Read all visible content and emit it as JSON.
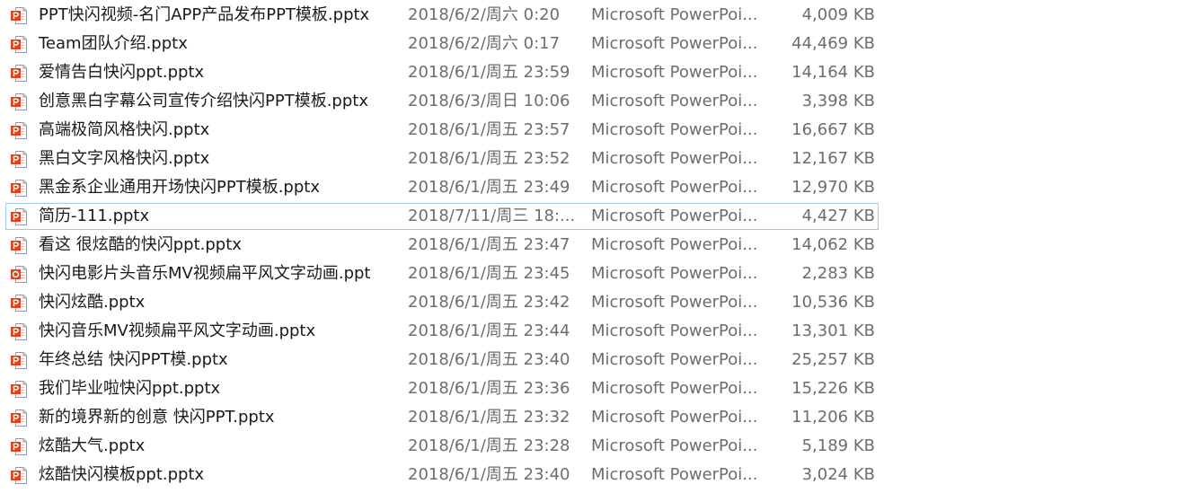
{
  "colors": {
    "accent_focus_border": "#99c9ef",
    "icon_red": "#d24726",
    "text_primary": "#1a1a1a",
    "text_secondary": "#6d6d6d"
  },
  "files": [
    {
      "name": "PPT快闪视频-名门APP产品发布PPT模板.pptx",
      "date": "2018/6/2/周六 0:20",
      "type": "Microsoft PowerPoi...",
      "size": "4,009 KB",
      "icon": "pptx-file-icon"
    },
    {
      "name": "Team团队介绍.pptx",
      "date": "2018/6/2/周六 0:17",
      "type": "Microsoft PowerPoi...",
      "size": "44,469 KB",
      "icon": "pptx-file-icon"
    },
    {
      "name": "爱情告白快闪ppt.pptx",
      "date": "2018/6/1/周五 23:59",
      "type": "Microsoft PowerPoi...",
      "size": "14,164 KB",
      "icon": "pptx-file-icon"
    },
    {
      "name": "创意黑白字幕公司宣传介绍快闪PPT模板.pptx",
      "date": "2018/6/3/周日 10:06",
      "type": "Microsoft PowerPoi...",
      "size": "3,398 KB",
      "icon": "pptx-file-icon"
    },
    {
      "name": "高端极简风格快闪.pptx",
      "date": "2018/6/1/周五 23:57",
      "type": "Microsoft PowerPoi...",
      "size": "16,667 KB",
      "icon": "pptx-file-icon"
    },
    {
      "name": "黑白文字风格快闪.pptx",
      "date": "2018/6/1/周五 23:52",
      "type": "Microsoft PowerPoi...",
      "size": "12,167 KB",
      "icon": "pptx-file-icon"
    },
    {
      "name": "黑金系企业通用开场快闪PPT模板.pptx",
      "date": "2018/6/1/周五 23:49",
      "type": "Microsoft PowerPoi...",
      "size": "12,970 KB",
      "icon": "pptx-file-icon"
    },
    {
      "name": "简历-111.pptx",
      "date": "2018/7/11/周三 18:...",
      "type": "Microsoft PowerPoi...",
      "size": "4,427 KB",
      "icon": "pptx-file-icon",
      "focused": true
    },
    {
      "name": "看这 很炫酷的快闪ppt.pptx",
      "date": "2018/6/1/周五 23:47",
      "type": "Microsoft PowerPoi...",
      "size": "14,062 KB",
      "icon": "pptx-file-icon"
    },
    {
      "name": "快闪电影片头音乐MV视频扁平风文字动画.ppt",
      "date": "2018/6/1/周五 23:45",
      "type": "Microsoft PowerPoi...",
      "size": "2,283 KB",
      "icon": "ppt-file-icon"
    },
    {
      "name": "快闪炫酷.pptx",
      "date": "2018/6/1/周五 23:42",
      "type": "Microsoft PowerPoi...",
      "size": "10,536 KB",
      "icon": "pptx-file-icon"
    },
    {
      "name": "快闪音乐MV视频扁平风文字动画.pptx",
      "date": "2018/6/1/周五 23:44",
      "type": "Microsoft PowerPoi...",
      "size": "13,301 KB",
      "icon": "pptx-file-icon"
    },
    {
      "name": "年终总结 快闪PPT模.pptx",
      "date": "2018/6/1/周五 23:40",
      "type": "Microsoft PowerPoi...",
      "size": "25,257 KB",
      "icon": "pptx-file-icon"
    },
    {
      "name": "我们毕业啦快闪ppt.pptx",
      "date": "2018/6/1/周五 23:36",
      "type": "Microsoft PowerPoi...",
      "size": "15,226 KB",
      "icon": "pptx-file-icon"
    },
    {
      "name": "新的境界新的创意 快闪PPT.pptx",
      "date": "2018/6/1/周五 23:32",
      "type": "Microsoft PowerPoi...",
      "size": "11,206 KB",
      "icon": "pptx-file-icon"
    },
    {
      "name": "炫酷大气.pptx",
      "date": "2018/6/1/周五 23:28",
      "type": "Microsoft PowerPoi...",
      "size": "5,189 KB",
      "icon": "pptx-file-icon"
    },
    {
      "name": "炫酷快闪模板ppt.pptx",
      "date": "2018/6/1/周五 23:40",
      "type": "Microsoft PowerPoi...",
      "size": "3,024 KB",
      "icon": "pptx-file-icon"
    }
  ]
}
